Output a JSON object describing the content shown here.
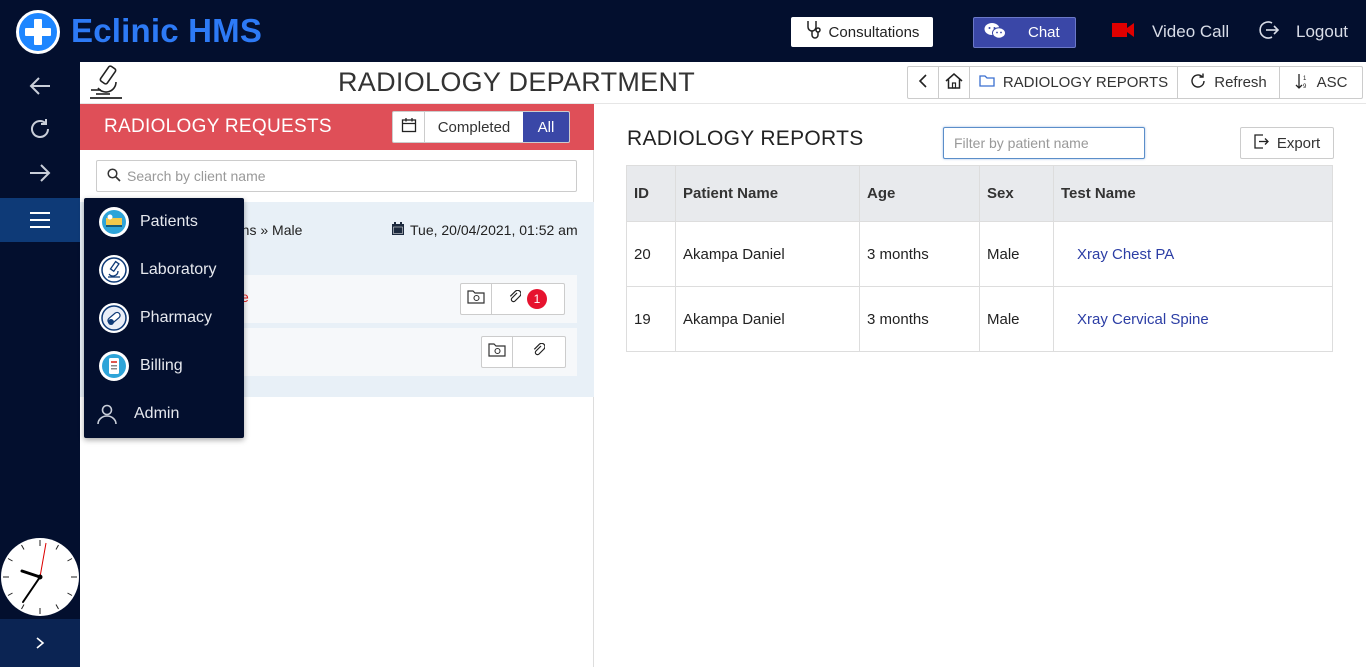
{
  "app": {
    "title": "Eclinic HMS"
  },
  "topbar": {
    "consultations_label": "Consultations",
    "chat_label": "Chat",
    "video_call_label": "Video Call",
    "logout_label": "Logout"
  },
  "page": {
    "title": "RADIOLOGY DEPARTMENT",
    "toolbar": {
      "reports_label": "RADIOLOGY REPORTS",
      "refresh_label": "Refresh",
      "sort_label": "ASC"
    }
  },
  "requests": {
    "title": "RADIOLOGY REQUESTS",
    "filter_completed": "Completed",
    "filter_all": "All",
    "search_placeholder": "Search by client name",
    "patient_meta": "nths » Male",
    "date": "Tue, 20/04/2021, 01:52 am",
    "rows": [
      {
        "test_fragment": "e",
        "attachment_count": "1"
      },
      {
        "test_fragment": "",
        "attachment_count": ""
      }
    ]
  },
  "nav_menu": {
    "items": [
      {
        "label": "Patients",
        "icon": "patients-icon"
      },
      {
        "label": "Laboratory",
        "icon": "laboratory-icon"
      },
      {
        "label": "Pharmacy",
        "icon": "pharmacy-icon"
      },
      {
        "label": "Billing",
        "icon": "billing-icon"
      },
      {
        "label": "Admin",
        "icon": "user-icon"
      }
    ]
  },
  "reports": {
    "title": "RADIOLOGY REPORTS",
    "filter_placeholder": "Filter by patient name",
    "export_label": "Export",
    "columns": [
      "ID",
      "Patient Name",
      "Age",
      "Sex",
      "Test Name"
    ],
    "rows": [
      {
        "id": "20",
        "patient": "Akampa Daniel",
        "age": "3 months",
        "sex": "Male",
        "test": "Xray Chest PA"
      },
      {
        "id": "19",
        "patient": "Akampa Daniel",
        "age": "3 months",
        "sex": "Male",
        "test": "Xray Cervical Spine"
      }
    ]
  },
  "colors": {
    "navy": "#030f2e",
    "brand_blue": "#2d7af6",
    "accent_indigo": "#3a47a7",
    "requests_header_red": "#df4f58",
    "link_blue": "#2c3ea5",
    "badge_red": "#e6132f"
  }
}
